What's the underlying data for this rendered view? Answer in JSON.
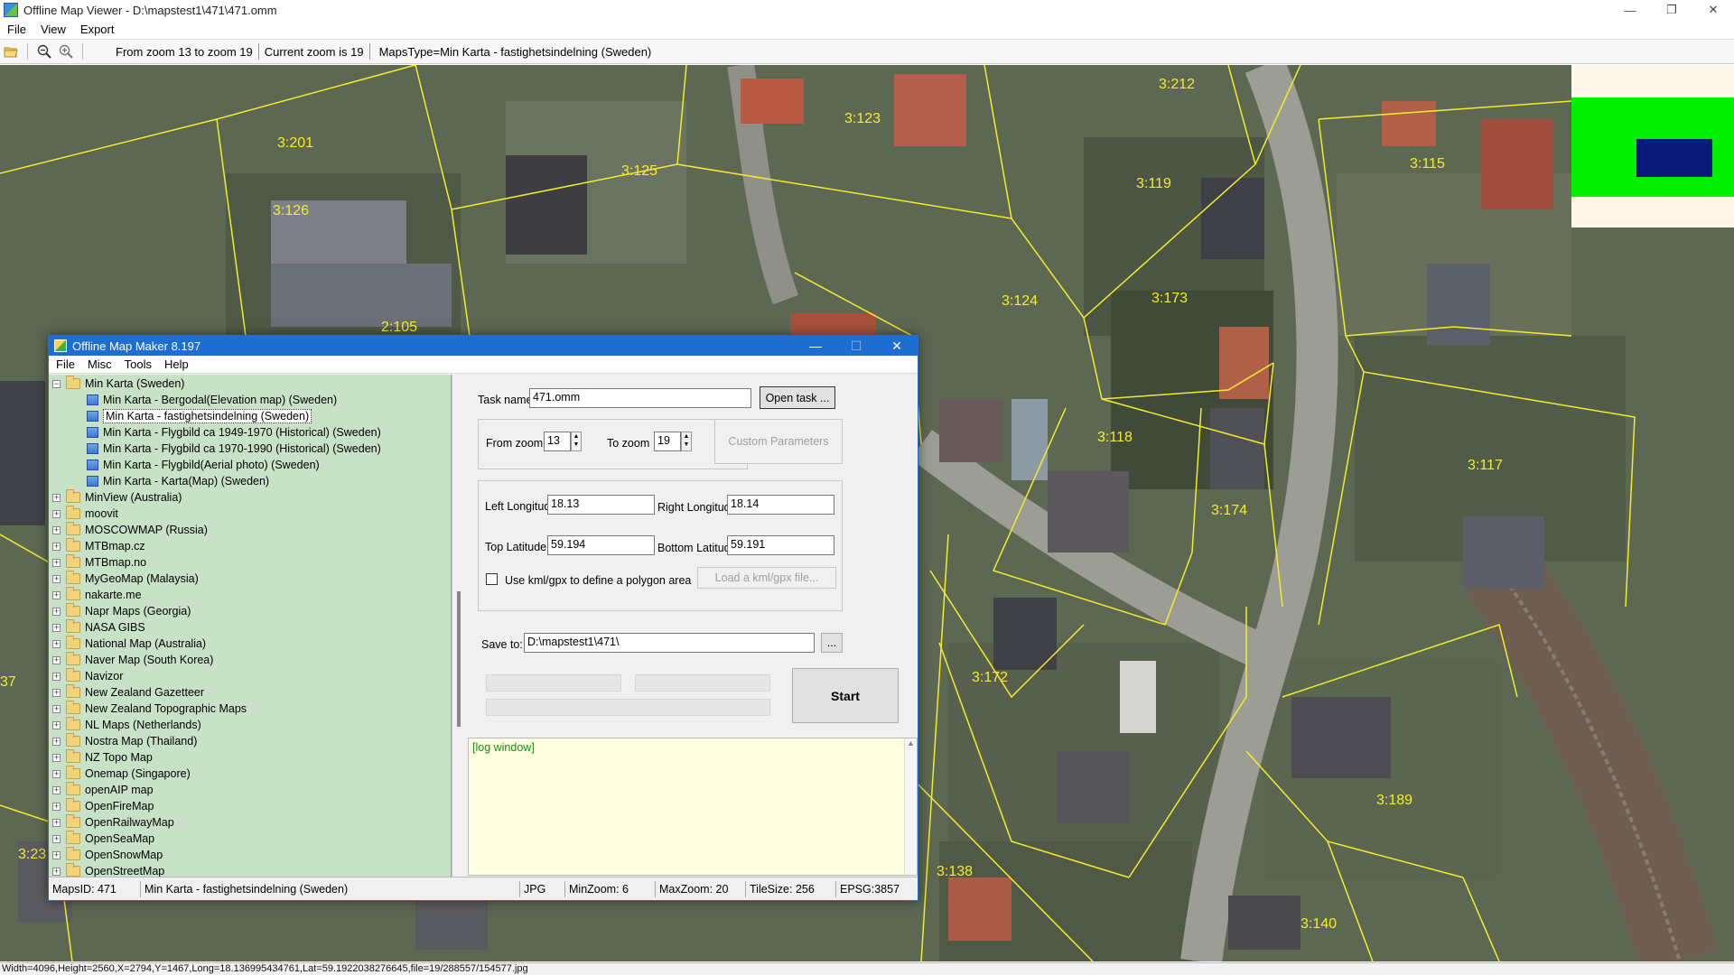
{
  "window": {
    "title": "Offline Map Viewer - D:\\mapstest1\\471\\471.omm",
    "controls": {
      "minimize": "—",
      "restore": "❐",
      "close": "✕"
    }
  },
  "menu": {
    "file": "File",
    "view": "View",
    "export": "Export"
  },
  "toolbar": {
    "zoom_range": "From zoom 13 to zoom 19",
    "current_zoom": "Current zoom is 19",
    "maps_type": "MapsType=Min Karta - fastighetsindelning (Sweden)"
  },
  "map": {
    "parcel_labels": [
      "3:201",
      "3:126",
      "3:125",
      "3:123",
      "3:212",
      "3:119",
      "3:115",
      "3:124",
      "3:173",
      "2:105",
      "3:118",
      "3:117",
      "3:174",
      "3:172",
      "3:189",
      "3:138",
      "3:140",
      "37",
      "3:23"
    ]
  },
  "status_main": "Width=4096,Height=2560,X=2794,Y=1467,Long=18.136995434761,Lat=59.1922038276645,file=19/288557/154577.jpg",
  "dialog": {
    "title": "Offline Map Maker 8.197",
    "controls": {
      "minimize": "—",
      "maximize": "☐",
      "close": "✕"
    },
    "menu": {
      "file": "File",
      "misc": "Misc",
      "tools": "Tools",
      "help": "Help"
    },
    "tree": {
      "root": "Min Karta (Sweden)",
      "children": [
        "Min Karta - Bergodal(Elevation map) (Sweden)",
        "Min Karta - fastighetsindelning (Sweden)",
        "Min Karta - Flygbild ca 1949-1970 (Historical) (Sweden)",
        "Min Karta - Flygbild ca 1970-1990 (Historical) (Sweden)",
        "Min Karta - Flygbild(Aerial photo) (Sweden)",
        "Min Karta - Karta(Map) (Sweden)"
      ],
      "selected_index": 1,
      "folders": [
        "MinView (Australia)",
        "moovit",
        "MOSCOWMAP (Russia)",
        "MTBmap.cz",
        "MTBmap.no",
        "MyGeoMap (Malaysia)",
        "nakarte.me",
        "Napr Maps (Georgia)",
        "NASA GIBS",
        "National Map (Australia)",
        "Naver Map (South Korea)",
        "Navizor",
        "New Zealand Gazetteer",
        "New Zealand Topographic Maps",
        "NL Maps (Netherlands)",
        "Nostra Map (Thailand)",
        "NZ Topo Map",
        "Onemap (Singapore)",
        "openAIP map",
        "OpenFireMap",
        "OpenRailwayMap",
        "OpenSeaMap",
        "OpenSnowMap",
        "OpenStreetMap"
      ]
    },
    "form": {
      "task_name_label": "Task name",
      "task_name_value": "471.omm",
      "open_task": "Open task ...",
      "from_zoom_label": "From zoom",
      "from_zoom_value": "13",
      "to_zoom_label": "To zoom",
      "to_zoom_value": "19",
      "custom_parameters": "Custom Parameters",
      "left_longitude_label": "Left Longitude",
      "left_longitude_value": "18.13",
      "right_longitude_label": "Right Longitude",
      "right_longitude_value": "18.14",
      "top_latitude_label": "Top Latitude",
      "top_latitude_value": "59.194",
      "bottom_latitude_label": "Bottom Latitude",
      "bottom_latitude_value": "59.191",
      "use_kml_label": "Use kml/gpx to define a polygon area",
      "load_kml": "Load a kml/gpx file...",
      "save_to_label": "Save to:",
      "save_to_value": "D:\\mapstest1\\471\\",
      "browse": "...",
      "start": "Start"
    },
    "log": "[log window]",
    "status": {
      "maps_id": "MapsID: 471",
      "maps_name": "Min Karta - fastighetsindelning (Sweden)",
      "format": "JPG",
      "min_zoom": "MinZoom: 6",
      "max_zoom": "MaxZoom: 20",
      "tile_size": "TileSize: 256",
      "epsg": "EPSG:3857"
    }
  },
  "colors": {
    "parcel_line": "#f4ec2a",
    "tree_bg": "#c8e2c8",
    "dialog_title": "#1e6ed2",
    "log_bg": "#ffffe0",
    "overview_green": "#00f000",
    "overview_navy": "#0a1a78"
  }
}
